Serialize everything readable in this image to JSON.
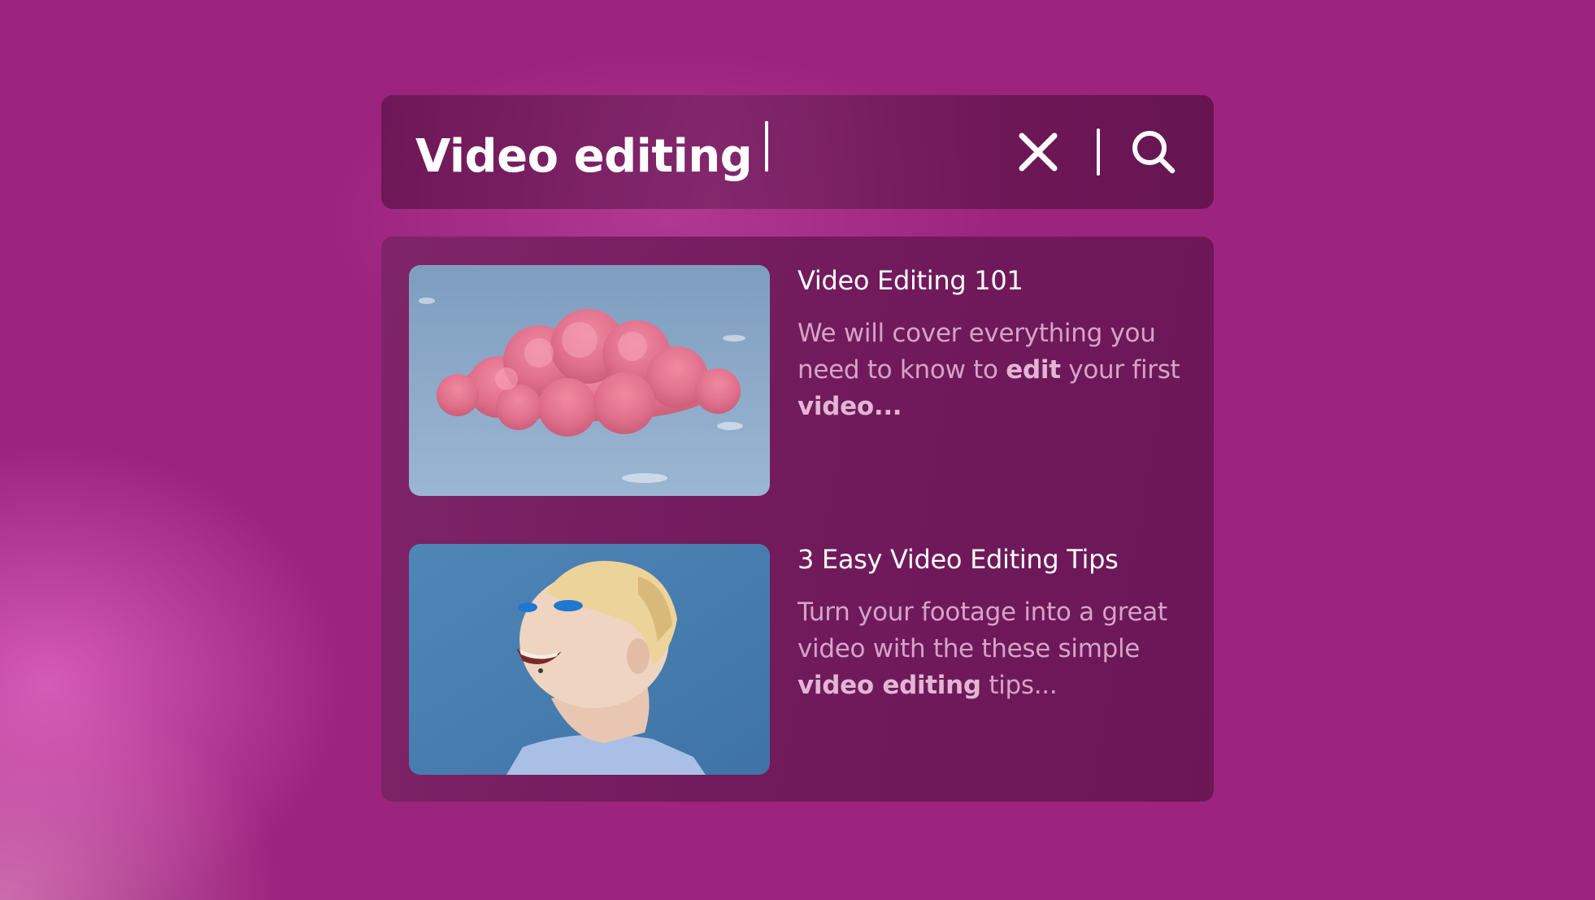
{
  "search": {
    "query": "Video editing",
    "clear_icon": "close-icon",
    "search_icon": "search-icon"
  },
  "results": [
    {
      "title": "Video Editing 101",
      "description_parts": [
        {
          "text": "We will cover everything you need to know to ",
          "bold": false
        },
        {
          "text": "edit",
          "bold": true
        },
        {
          "text": " your first ",
          "bold": false
        },
        {
          "text": "video",
          "bold": true
        },
        {
          "text": "...",
          "bold": false
        }
      ],
      "thumbnail": "pink cloud in blue sky"
    },
    {
      "title": "3 Easy Video Editing Tips",
      "description_parts": [
        {
          "text": "Turn your footage into a great video with the these simple ",
          "bold": false
        },
        {
          "text": "video editing",
          "bold": true
        },
        {
          "text": " tips...",
          "bold": false
        }
      ],
      "thumbnail": "smiling person with blue eyeshadow against blue background"
    }
  ],
  "colors": {
    "background": "#9c237e",
    "panel": "#6e1a5a",
    "title_text": "#ffffff",
    "description_text": "#d6a3c8"
  }
}
